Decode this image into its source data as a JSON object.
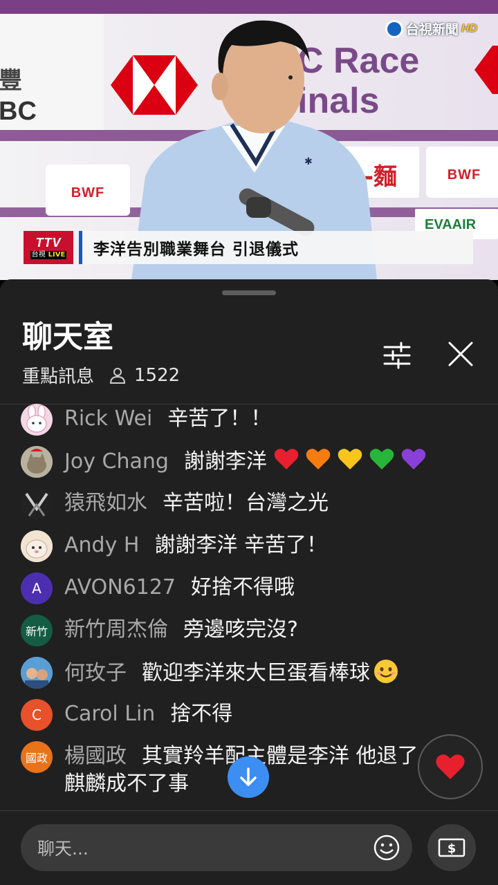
{
  "video": {
    "backdrop_text_line1": "C Race",
    "backdrop_text_line2": "inals",
    "backdrop_left_chars_1": "豐",
    "backdrop_left_chars_2": "BC",
    "bwf_label": "BWF",
    "sponsor_text": "EVAAIR",
    "sponsor_text_2": "-麵",
    "watermark": "台視新聞",
    "watermark_hd": "HD",
    "channel_logo": "TTV",
    "channel_name": "台視",
    "live_badge": "LIVE",
    "ticker_headline": "李洋告別職業舞台 引退儀式",
    "accent_color": "#c8102e"
  },
  "chat": {
    "title": "聊天室",
    "mode_label": "重點訊息",
    "viewer_count": "1522",
    "messages": [
      {
        "author": "Rick Wei",
        "text": "辛苦了！！",
        "avatar": "bunny-avatar"
      },
      {
        "author": "Joy Chang",
        "text": "謝謝李洋",
        "hearts": [
          "#e8202e",
          "#f57c0f",
          "#f7c51c",
          "#27b53a",
          "#8b3fd9"
        ],
        "avatar": "cat-photo-avatar"
      },
      {
        "author": "猿飛如水",
        "text": "辛苦啦！台灣之光",
        "avatar": "dark-photo-avatar"
      },
      {
        "author": "Andy H",
        "text": "謝謝李洋 辛苦了！",
        "avatar": "cat-photo-avatar"
      },
      {
        "author": "AVON6127",
        "text": "好捨不得哦",
        "avatar_letter": "A",
        "avatar_color": "#4b2fb0"
      },
      {
        "author": "新竹周杰倫",
        "text": "旁邊咳完沒?",
        "avatar_letter": "新竹",
        "avatar_color": "#145c43"
      },
      {
        "author": "何玫子",
        "text": "歡迎李洋來大巨蛋看棒球",
        "avatar": "kids-photo-avatar"
      },
      {
        "author": "Carol Lin",
        "text": "捨不得",
        "avatar_letter": "C",
        "avatar_color": "#e8512a"
      },
      {
        "author": "楊國政",
        "text": "其實羚羊配主體是李洋 他退了",
        "text_line2": "麒麟成不了事",
        "avatar_letter": "國政",
        "avatar_color": "#e8731a"
      }
    ],
    "input_placeholder": "聊天..."
  }
}
